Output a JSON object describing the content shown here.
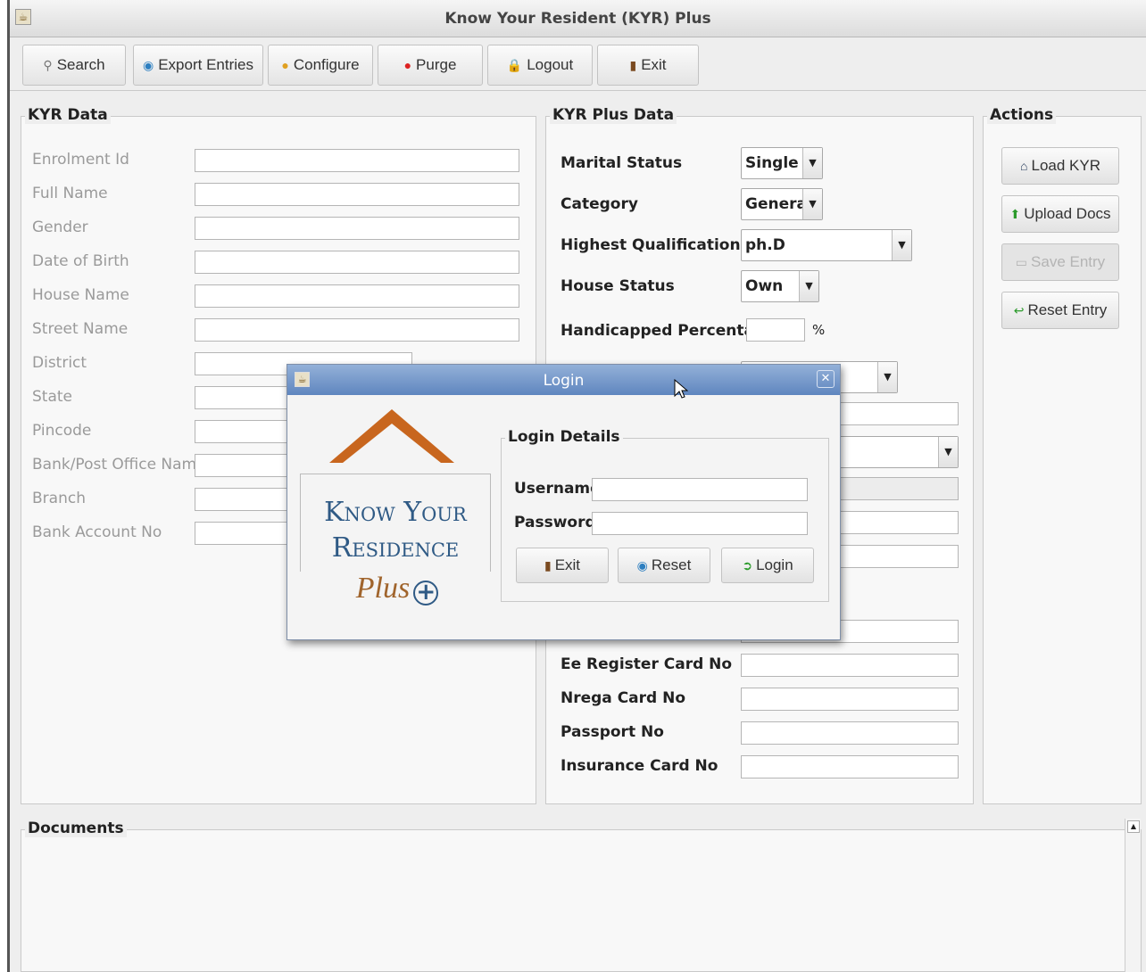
{
  "window": {
    "title": "Know Your Resident (KYR) Plus"
  },
  "toolbar": {
    "search": "Search",
    "export": "Export Entries",
    "configure": "Configure",
    "purge": "Purge",
    "logout": "Logout",
    "exit": "Exit"
  },
  "kyr_data": {
    "title": "KYR Data",
    "fields": [
      "Enrolment Id",
      "Full Name",
      "Gender",
      "Date of Birth",
      "House Name",
      "Street Name",
      "District",
      "State",
      "Pincode",
      "Bank/Post Office Name",
      "Branch",
      "Bank Account No"
    ]
  },
  "kyr_plus": {
    "title": "KYR Plus Data",
    "marital_status": {
      "label": "Marital Status",
      "value": "Single"
    },
    "category": {
      "label": "Category",
      "value": "General"
    },
    "qualification": {
      "label": "Highest Qualification",
      "value": "ph.D"
    },
    "house_status": {
      "label": "House Status",
      "value": "Own"
    },
    "handicapped": {
      "label": "Handicapped Percentage",
      "unit": "%"
    },
    "ee_register": "Ee Register Card No",
    "nrega": "Nrega Card No",
    "passport": "Passport No",
    "insurance": "Insurance Card No"
  },
  "actions": {
    "title": "Actions",
    "load": "Load KYR",
    "upload": "Upload Docs",
    "save": "Save Entry",
    "reset": "Reset Entry"
  },
  "documents": {
    "title": "Documents"
  },
  "login": {
    "title": "Login",
    "details_title": "Login Details",
    "username_label": "Username",
    "password_label": "Password",
    "exit": "Exit",
    "reset": "Reset",
    "login": "Login",
    "logo_line1": "Know Your",
    "logo_line2": "Residence",
    "logo_plus": "Plus"
  }
}
